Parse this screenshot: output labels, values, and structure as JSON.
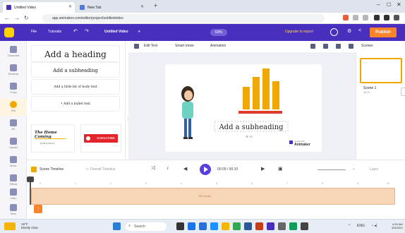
{
  "browser": {
    "tabs": [
      {
        "label": "Untitled Video"
      },
      {
        "label": "New Tab"
      }
    ],
    "url": "app.animaker.com/editor/project/untitledvideo"
  },
  "app": {
    "menu": {
      "file": "File",
      "tutorials": "Tutorials",
      "title": "Untitled Video",
      "zoom": "60%",
      "upgrade": "Upgrade to export",
      "publish": "Publish"
    },
    "rail": [
      "Characters",
      "Elements",
      "Props",
      "Text",
      "BG",
      "Upload",
      "Music",
      "Effects",
      "Video",
      "More"
    ]
  },
  "text_panel": {
    "heading": "Add a heading",
    "subheading": "Add a subheading",
    "body": "Add a little bit of body text",
    "bullet": "Add a bullet text",
    "template_title": "The Home Coming",
    "template_sub": "STRATEGY",
    "subscribe": "SUBSCRIBE"
  },
  "toolbar": {
    "edit_text": "Edit Text",
    "smart_move": "Smart move",
    "animation": "Animation",
    "scenes": "Scenes"
  },
  "canvas": {
    "subheading": "Add a subheading",
    "brand_by": "create with",
    "brand": "Animaker"
  },
  "scenes": {
    "label": "Scene 1",
    "duration": "00:10"
  },
  "timeline": {
    "scene_timeline": "Scene Timeline",
    "overall_timeline": "Overall Timeline",
    "time": "00:00 / 00:10",
    "zoom": "Layer",
    "track_label": "BG Audio",
    "ticks": [
      "0",
      "1",
      "2",
      "3",
      "4",
      "5",
      "6",
      "7",
      "8",
      "9",
      "10"
    ]
  },
  "taskbar": {
    "weather_temp": "19°F",
    "weather_desc": "Mostly clear",
    "search": "Search",
    "lang": "ENG",
    "time": "4:30 AM",
    "date": "3/9/2023"
  },
  "colors": {
    "app_purple": "#4a2fbf",
    "accent_orange": "#f7832a",
    "bar_orange": "#f0a800",
    "subheading_bar": "#e03a2a"
  }
}
